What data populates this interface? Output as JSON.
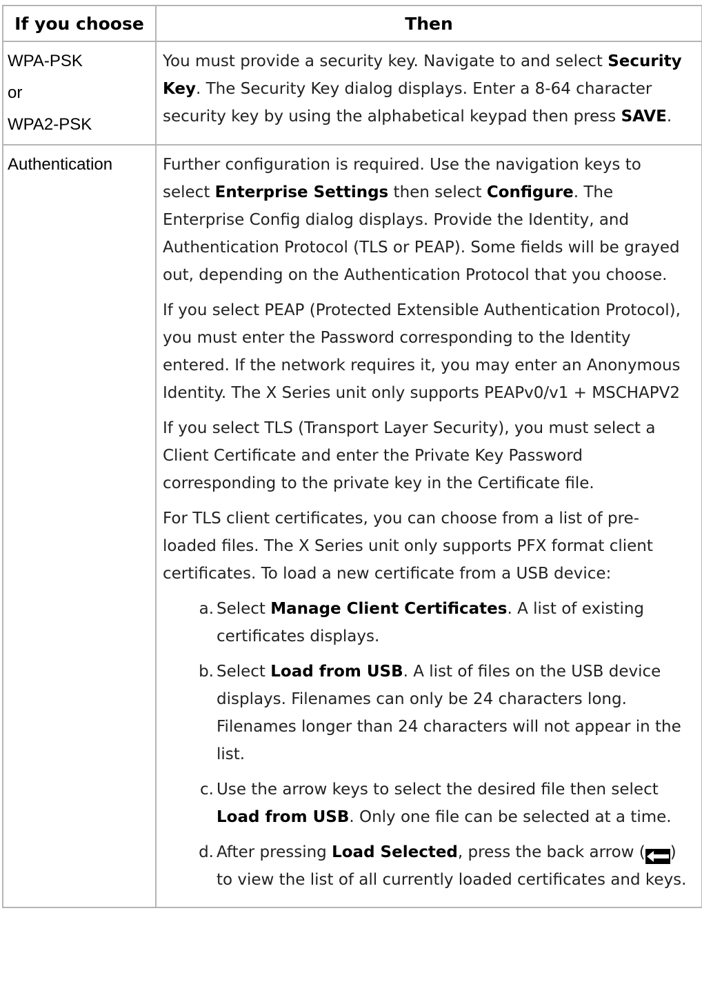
{
  "headers": {
    "choice": "If you choose",
    "then": "Then"
  },
  "rows": {
    "psk": {
      "choices": [
        "WPA-PSK",
        "or",
        "WPA2-PSK"
      ],
      "p1": {
        "a": "You must provide a security key. Navigate to and select ",
        "b": "Security Key",
        "c": ". The Security Key dialog displays. Enter a 8-64 character security key by using the alphabetical keypad then press ",
        "d": "SAVE",
        "e": "."
      }
    },
    "auth": {
      "choice": "Authentication",
      "p1": {
        "a": "Further configuration is required. Use the navigation keys to select ",
        "b": "Enterprise Settings",
        "c": " then select ",
        "d": "Configure",
        "e": ". The Enterprise Config dialog displays. Provide the Identity, and Authentication Protocol (TLS or PEAP). Some fields will be grayed out, depending on the Authentication Protocol that you choose."
      },
      "p2": "If you select PEAP (Protected Extensible Authentication Protocol), you must enter the Password corresponding to the Identity entered. If the network requires it, you may enter an Anonymous Identity. The X Series unit only supports PEAPv0/v1 + MSCHAPV2",
      "p3": "If you select TLS (Transport Layer Security), you must select a Client Certificate and enter the Private Key Password corresponding to the private key in the Certificate file.",
      "p4": "For TLS client certificates, you can choose from a list of pre-loaded files. The X Series unit only supports PFX format client certificates. To load a new certificate from a USB device:",
      "steps": {
        "a": {
          "mark": "a.",
          "pre": "Select ",
          "bold": "Manage Client Certificates",
          "post": ". A list of existing certificates displays."
        },
        "b": {
          "mark": "b.",
          "pre": "Select ",
          "bold": "Load from USB",
          "post": ". A list of files on the USB device displays. Filenames can only be 24 characters long. Filenames longer than 24 characters will not appear in the list."
        },
        "c": {
          "mark": "c.",
          "pre": "Use the arrow keys to select the desired file then select ",
          "bold": "Load from USB",
          "post": ". Only one file can be selected at a time."
        },
        "d": {
          "mark": "d.",
          "pre": "After pressing ",
          "bold": "Load Selected",
          "mid": ", press the back arrow (",
          "post": ") to view the list of all currently loaded certificates and keys."
        }
      }
    }
  }
}
